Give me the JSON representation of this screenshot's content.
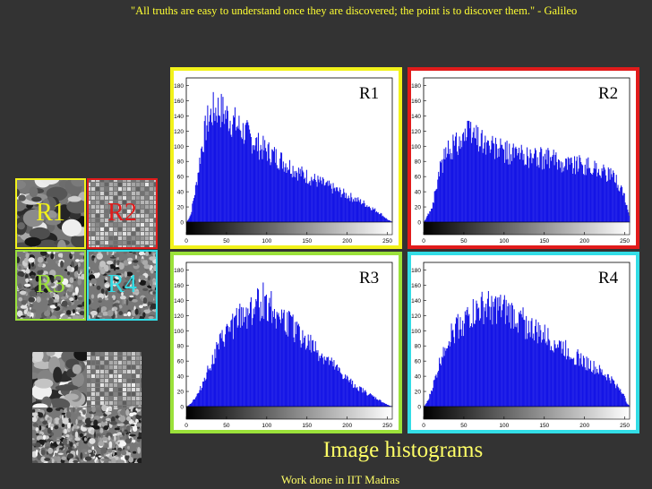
{
  "quote": "\"All truths are easy to understand once they are discovered; the point is to discover them.\" - Galileo",
  "caption": "Image histograms",
  "credit": "Work done in IIT Madras",
  "colors": {
    "R1": "#f2f21a",
    "R2": "#e11b1b",
    "R3": "#9be13a",
    "R4": "#33dde6",
    "bars": "#1515e6"
  },
  "textures": [
    {
      "label": "R1"
    },
    {
      "label": "R2"
    },
    {
      "label": "R3"
    },
    {
      "label": "R4"
    }
  ],
  "chart_data": [
    {
      "type": "bar",
      "label": "R1",
      "ylim": [
        0,
        190
      ],
      "xlim": [
        0,
        256
      ],
      "yticks": [
        "0",
        "20",
        "40",
        "60",
        "80",
        "100",
        "120",
        "140",
        "160",
        "180"
      ],
      "xticks": [
        "0",
        "50",
        "100",
        "150",
        "200",
        "250"
      ],
      "envelope_x": [
        0,
        5,
        12,
        18,
        25,
        32,
        38,
        45,
        55,
        65,
        75,
        90,
        105,
        120,
        140,
        160,
        180,
        200,
        220,
        240,
        250,
        256
      ],
      "envelope_y": [
        0,
        10,
        50,
        95,
        130,
        145,
        150,
        145,
        135,
        125,
        115,
        100,
        90,
        80,
        65,
        55,
        45,
        35,
        25,
        12,
        3,
        0
      ]
    },
    {
      "type": "bar",
      "label": "R2",
      "ylim": [
        0,
        190
      ],
      "xlim": [
        0,
        256
      ],
      "yticks": [
        "0",
        "20",
        "40",
        "60",
        "80",
        "100",
        "120",
        "140",
        "160",
        "180"
      ],
      "xticks": [
        "0",
        "50",
        "100",
        "150",
        "200",
        "250"
      ],
      "envelope_x": [
        0,
        10,
        20,
        30,
        40,
        50,
        60,
        70,
        80,
        100,
        120,
        140,
        160,
        180,
        200,
        220,
        240,
        250,
        256
      ],
      "envelope_y": [
        0,
        20,
        70,
        95,
        105,
        115,
        118,
        110,
        100,
        92,
        88,
        85,
        82,
        78,
        75,
        68,
        55,
        30,
        5
      ]
    },
    {
      "type": "bar",
      "label": "R3",
      "ylim": [
        0,
        190
      ],
      "xlim": [
        0,
        256
      ],
      "yticks": [
        "0",
        "20",
        "40",
        "60",
        "80",
        "100",
        "120",
        "140",
        "160",
        "180"
      ],
      "xticks": [
        "0",
        "50",
        "100",
        "150",
        "200",
        "250"
      ],
      "envelope_x": [
        0,
        5,
        15,
        25,
        40,
        55,
        70,
        85,
        95,
        105,
        115,
        130,
        145,
        160,
        180,
        200,
        220,
        240,
        250,
        256
      ],
      "envelope_y": [
        0,
        4,
        18,
        45,
        80,
        105,
        120,
        132,
        140,
        132,
        120,
        105,
        90,
        75,
        55,
        35,
        20,
        8,
        2,
        0
      ]
    },
    {
      "type": "bar",
      "label": "R4",
      "ylim": [
        0,
        190
      ],
      "xlim": [
        0,
        256
      ],
      "yticks": [
        "0",
        "20",
        "40",
        "60",
        "80",
        "100",
        "120",
        "140",
        "160",
        "180"
      ],
      "xticks": [
        "0",
        "50",
        "100",
        "150",
        "200",
        "250"
      ],
      "envelope_x": [
        0,
        5,
        15,
        25,
        40,
        55,
        70,
        85,
        100,
        115,
        130,
        150,
        170,
        190,
        210,
        230,
        245,
        252,
        256
      ],
      "envelope_y": [
        0,
        8,
        40,
        80,
        105,
        118,
        128,
        130,
        125,
        118,
        105,
        92,
        80,
        65,
        52,
        38,
        22,
        5,
        0
      ]
    }
  ]
}
